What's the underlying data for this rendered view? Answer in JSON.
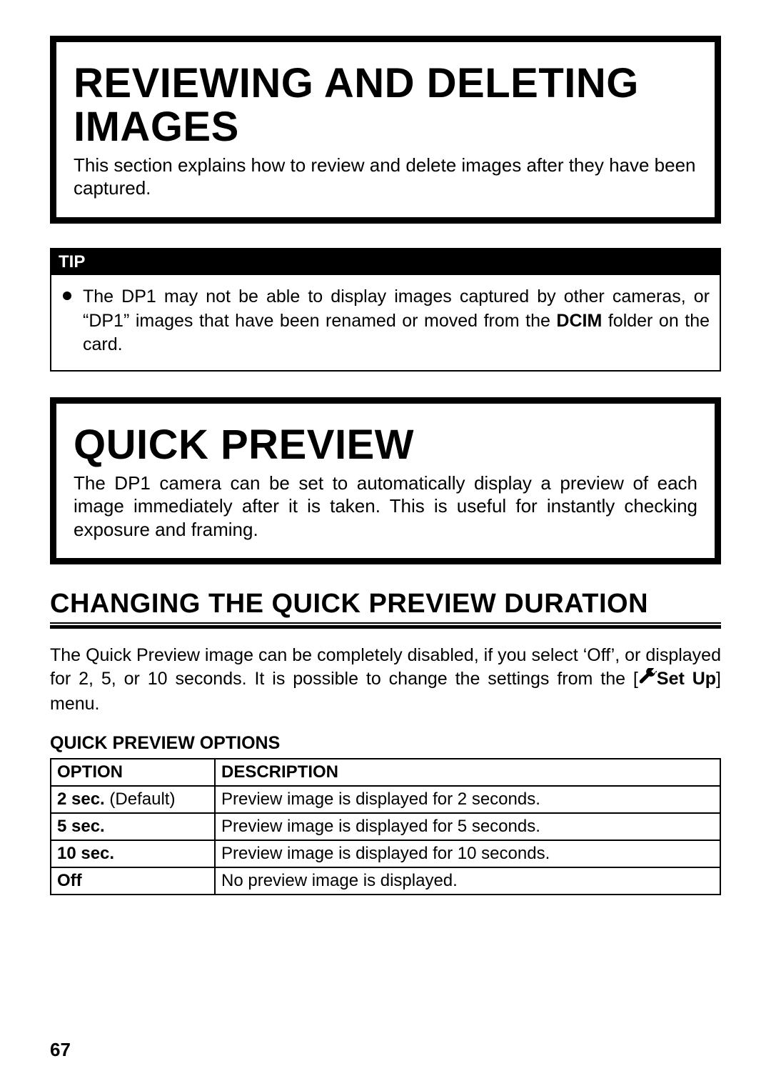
{
  "hero1": {
    "title": "REVIEWING AND DELETING IMAGES",
    "desc": "This section explains how to review and delete images after they have been captured."
  },
  "tip": {
    "label": "TIP",
    "item_pre": "The DP1 may not be able to display images captured by other cameras, or “DP1” images that have been renamed or moved from the ",
    "item_bold": "DCIM",
    "item_post": " folder on the card."
  },
  "hero2": {
    "title": "QUICK PREVIEW",
    "desc": "The DP1 camera can be set to automatically display a preview of each image immediately after it is taken.  This is useful for instantly checking exposure and framing."
  },
  "section": {
    "heading": "CHANGING THE QUICK PREVIEW DURATION",
    "para_pre": "The Quick Preview image can be completely disabled, if you select ‘Off’, or displayed for 2, 5, or 10 seconds. It is possible to change the settings from the [",
    "setup_label": "Set Up",
    "para_post": "] menu."
  },
  "table": {
    "title": "QUICK PREVIEW OPTIONS",
    "headers": {
      "option": "OPTION",
      "description": "DESCRIPTION"
    },
    "rows": [
      {
        "option": "2 sec.",
        "note": " (Default)",
        "description": "Preview image is displayed for 2 seconds."
      },
      {
        "option": "5 sec.",
        "note": "",
        "description": "Preview image is displayed for 5 seconds."
      },
      {
        "option": "10 sec.",
        "note": "",
        "description": "Preview image is displayed for 10 seconds."
      },
      {
        "option": "Off",
        "note": "",
        "description": "No preview image is displayed."
      }
    ]
  },
  "page_number": "67"
}
